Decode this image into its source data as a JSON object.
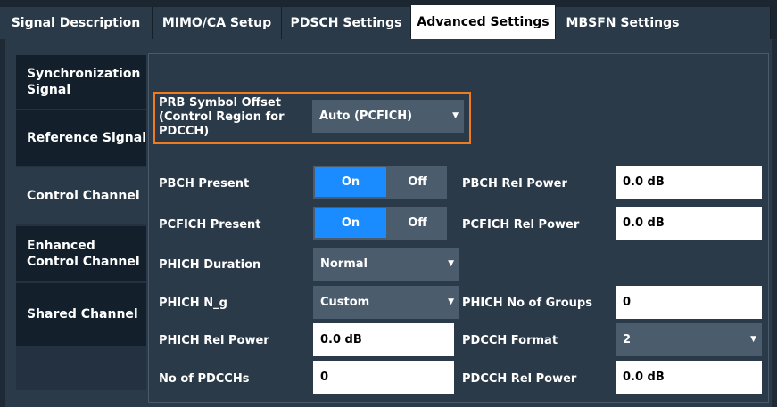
{
  "tabs": [
    {
      "label": "Signal Description"
    },
    {
      "label": "MIMO/CA Setup"
    },
    {
      "label": "PDSCH Settings"
    },
    {
      "label": "Advanced Settings",
      "active": true
    },
    {
      "label": "MBSFN Settings"
    }
  ],
  "sidebar": {
    "items": [
      {
        "label": "Synchronization Signal"
      },
      {
        "label": "Reference Signal"
      },
      {
        "label": "Control Channel",
        "active": true
      },
      {
        "label": "Enhanced Control Channel"
      },
      {
        "label": "Shared Channel"
      }
    ]
  },
  "form": {
    "prb_symbol_offset": {
      "label": "PRB Symbol Offset (Control Region for PDCCH)",
      "value": "Auto (PCFICH)"
    },
    "pbch_present": {
      "label": "PBCH Present",
      "on": "On",
      "off": "Off",
      "selected": "On"
    },
    "pbch_rel_power": {
      "label": "PBCH Rel Power",
      "value": "0.0 dB"
    },
    "pcfich_present": {
      "label": "PCFICH Present",
      "on": "On",
      "off": "Off",
      "selected": "On"
    },
    "pcfich_rel_power": {
      "label": "PCFICH Rel Power",
      "value": "0.0 dB"
    },
    "phich_duration": {
      "label": "PHICH Duration",
      "value": "Normal"
    },
    "phich_ng": {
      "label": "PHICH N_g",
      "value": "Custom"
    },
    "phich_no_groups": {
      "label": "PHICH No of Groups",
      "value": "0"
    },
    "phich_rel_power": {
      "label": "PHICH Rel Power",
      "value": "0.0 dB"
    },
    "pdcch_format": {
      "label": "PDCCH Format",
      "value": "2"
    },
    "no_of_pdcchs": {
      "label": "No of PDCCHs",
      "value": "0"
    },
    "pdcch_rel_power": {
      "label": "PDCCH Rel Power",
      "value": "0.0 dB"
    }
  },
  "colors": {
    "accent": "#1a8cff",
    "highlight": "#f07a1e",
    "background": "#2b3a48"
  },
  "icons": {
    "dropdown": "chevron-down-icon"
  }
}
